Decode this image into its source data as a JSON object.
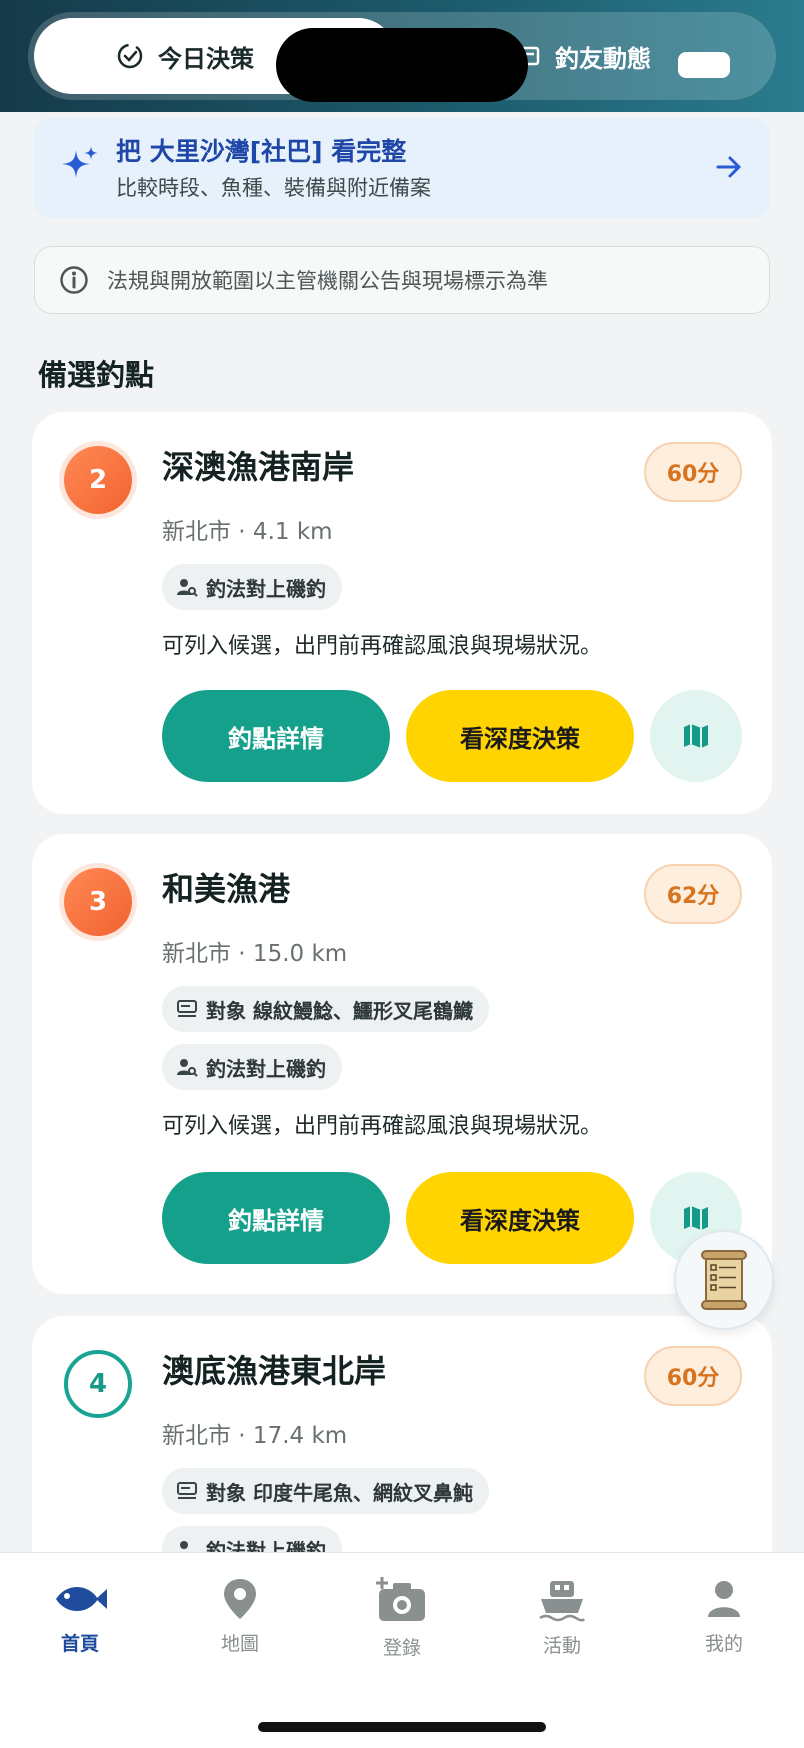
{
  "header": {
    "tab_today": "今日決策",
    "tab_activity": "釣友動態"
  },
  "banner": {
    "title": "把 大里沙灣[社巴] 看完整",
    "subtitle": "比較時段、魚種、裝備與附近備案"
  },
  "notice": {
    "text": "法規與開放範圍以主管機關公告與現場標示為準"
  },
  "section_title": "備選釣點",
  "cards": [
    {
      "rank": "2",
      "name": "深澳漁港南岸",
      "score": "60分",
      "meta": "新北市 · 4.1 km",
      "chips": [
        "釣法對上磯釣"
      ],
      "desc": "可列入候選，出門前再確認風浪與現場狀況。",
      "detail_label": "釣點詳情",
      "deep_label": "看深度決策"
    },
    {
      "rank": "3",
      "name": "和美漁港",
      "score": "62分",
      "meta": "新北市 · 15.0 km",
      "chips": [
        "對象 線紋鰻鯰、鱷形叉尾鶴鱵",
        "釣法對上磯釣"
      ],
      "desc": "可列入候選，出門前再確認風浪與現場狀況。",
      "detail_label": "釣點詳情",
      "deep_label": "看深度決策"
    },
    {
      "rank": "4",
      "name": "澳底漁港東北岸",
      "score": "60分",
      "meta": "新北市 · 17.4 km",
      "chips": [
        "對象 印度牛尾魚、網紋叉鼻魨",
        "釣法對上磯釣"
      ]
    }
  ],
  "nav": [
    {
      "label": "首頁",
      "icon": "fish-icon",
      "active": true
    },
    {
      "label": "地圖",
      "icon": "map-pin-icon"
    },
    {
      "label": "登錄",
      "icon": "camera-plus-icon"
    },
    {
      "label": "活動",
      "icon": "boat-icon"
    },
    {
      "label": "我的",
      "icon": "person-icon"
    }
  ],
  "colors": {
    "primary_teal": "#14a08b",
    "accent_yellow": "#ffd400",
    "nav_active": "#1f4c9c",
    "score_orange": "#d8731e"
  }
}
